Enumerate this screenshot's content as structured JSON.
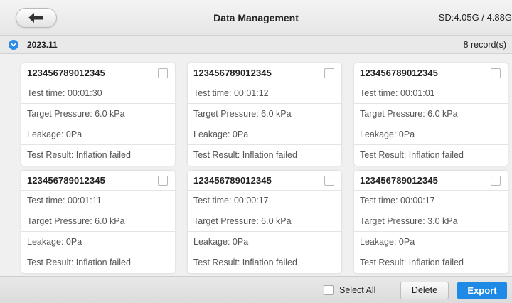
{
  "header": {
    "title": "Data Management",
    "storage": "SD:4.05G / 4.88G",
    "back_icon": "back-arrow-icon"
  },
  "group": {
    "label": "2023.11",
    "count": "8 record(s)",
    "expand_icon": "chevron-down-icon"
  },
  "records": [
    {
      "id": "123456789012345",
      "test_time": "Test time: 00:01:30",
      "pressure": "Target Pressure: 6.0 kPa",
      "leakage": "Leakage: 0Pa",
      "result": "Test Result: Inflation failed"
    },
    {
      "id": "123456789012345",
      "test_time": "Test time: 00:01:12",
      "pressure": "Target Pressure: 6.0 kPa",
      "leakage": "Leakage: 0Pa",
      "result": "Test Result: Inflation failed"
    },
    {
      "id": "123456789012345",
      "test_time": "Test time: 00:01:01",
      "pressure": "Target Pressure: 6.0 kPa",
      "leakage": "Leakage: 0Pa",
      "result": "Test Result: Inflation failed"
    },
    {
      "id": "123456789012345",
      "test_time": "Test time: 00:01:11",
      "pressure": "Target Pressure: 6.0 kPa",
      "leakage": "Leakage: 0Pa",
      "result": "Test Result: Inflation failed"
    },
    {
      "id": "123456789012345",
      "test_time": "Test time: 00:00:17",
      "pressure": "Target Pressure: 6.0 kPa",
      "leakage": "Leakage: 0Pa",
      "result": "Test Result: Inflation failed"
    },
    {
      "id": "123456789012345",
      "test_time": "Test time: 00:00:17",
      "pressure": "Target Pressure: 3.0 kPa",
      "leakage": "Leakage: 0Pa",
      "result": "Test Result: Inflation failed"
    }
  ],
  "footer": {
    "select_all": "Select All",
    "delete": "Delete",
    "export": "Export"
  },
  "colors": {
    "accent": "#1f8ae6",
    "group_icon": "#2b8de8"
  }
}
